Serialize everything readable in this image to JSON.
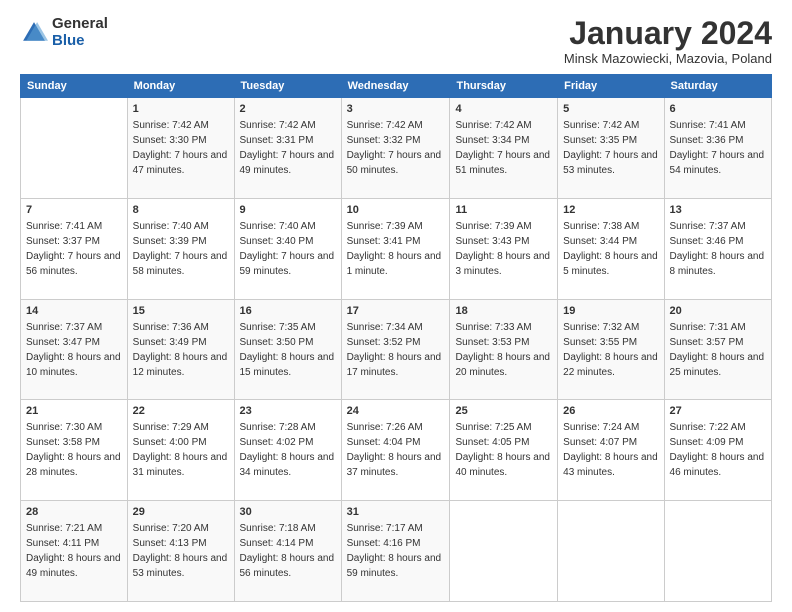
{
  "logo": {
    "general": "General",
    "blue": "Blue"
  },
  "header": {
    "month": "January 2024",
    "location": "Minsk Mazowiecki, Mazovia, Poland"
  },
  "days_of_week": [
    "Sunday",
    "Monday",
    "Tuesday",
    "Wednesday",
    "Thursday",
    "Friday",
    "Saturday"
  ],
  "weeks": [
    [
      {
        "day": "",
        "sunrise": "",
        "sunset": "",
        "daylight": ""
      },
      {
        "day": "1",
        "sunrise": "Sunrise: 7:42 AM",
        "sunset": "Sunset: 3:30 PM",
        "daylight": "Daylight: 7 hours and 47 minutes."
      },
      {
        "day": "2",
        "sunrise": "Sunrise: 7:42 AM",
        "sunset": "Sunset: 3:31 PM",
        "daylight": "Daylight: 7 hours and 49 minutes."
      },
      {
        "day": "3",
        "sunrise": "Sunrise: 7:42 AM",
        "sunset": "Sunset: 3:32 PM",
        "daylight": "Daylight: 7 hours and 50 minutes."
      },
      {
        "day": "4",
        "sunrise": "Sunrise: 7:42 AM",
        "sunset": "Sunset: 3:34 PM",
        "daylight": "Daylight: 7 hours and 51 minutes."
      },
      {
        "day": "5",
        "sunrise": "Sunrise: 7:42 AM",
        "sunset": "Sunset: 3:35 PM",
        "daylight": "Daylight: 7 hours and 53 minutes."
      },
      {
        "day": "6",
        "sunrise": "Sunrise: 7:41 AM",
        "sunset": "Sunset: 3:36 PM",
        "daylight": "Daylight: 7 hours and 54 minutes."
      }
    ],
    [
      {
        "day": "7",
        "sunrise": "Sunrise: 7:41 AM",
        "sunset": "Sunset: 3:37 PM",
        "daylight": "Daylight: 7 hours and 56 minutes."
      },
      {
        "day": "8",
        "sunrise": "Sunrise: 7:40 AM",
        "sunset": "Sunset: 3:39 PM",
        "daylight": "Daylight: 7 hours and 58 minutes."
      },
      {
        "day": "9",
        "sunrise": "Sunrise: 7:40 AM",
        "sunset": "Sunset: 3:40 PM",
        "daylight": "Daylight: 7 hours and 59 minutes."
      },
      {
        "day": "10",
        "sunrise": "Sunrise: 7:39 AM",
        "sunset": "Sunset: 3:41 PM",
        "daylight": "Daylight: 8 hours and 1 minute."
      },
      {
        "day": "11",
        "sunrise": "Sunrise: 7:39 AM",
        "sunset": "Sunset: 3:43 PM",
        "daylight": "Daylight: 8 hours and 3 minutes."
      },
      {
        "day": "12",
        "sunrise": "Sunrise: 7:38 AM",
        "sunset": "Sunset: 3:44 PM",
        "daylight": "Daylight: 8 hours and 5 minutes."
      },
      {
        "day": "13",
        "sunrise": "Sunrise: 7:37 AM",
        "sunset": "Sunset: 3:46 PM",
        "daylight": "Daylight: 8 hours and 8 minutes."
      }
    ],
    [
      {
        "day": "14",
        "sunrise": "Sunrise: 7:37 AM",
        "sunset": "Sunset: 3:47 PM",
        "daylight": "Daylight: 8 hours and 10 minutes."
      },
      {
        "day": "15",
        "sunrise": "Sunrise: 7:36 AM",
        "sunset": "Sunset: 3:49 PM",
        "daylight": "Daylight: 8 hours and 12 minutes."
      },
      {
        "day": "16",
        "sunrise": "Sunrise: 7:35 AM",
        "sunset": "Sunset: 3:50 PM",
        "daylight": "Daylight: 8 hours and 15 minutes."
      },
      {
        "day": "17",
        "sunrise": "Sunrise: 7:34 AM",
        "sunset": "Sunset: 3:52 PM",
        "daylight": "Daylight: 8 hours and 17 minutes."
      },
      {
        "day": "18",
        "sunrise": "Sunrise: 7:33 AM",
        "sunset": "Sunset: 3:53 PM",
        "daylight": "Daylight: 8 hours and 20 minutes."
      },
      {
        "day": "19",
        "sunrise": "Sunrise: 7:32 AM",
        "sunset": "Sunset: 3:55 PM",
        "daylight": "Daylight: 8 hours and 22 minutes."
      },
      {
        "day": "20",
        "sunrise": "Sunrise: 7:31 AM",
        "sunset": "Sunset: 3:57 PM",
        "daylight": "Daylight: 8 hours and 25 minutes."
      }
    ],
    [
      {
        "day": "21",
        "sunrise": "Sunrise: 7:30 AM",
        "sunset": "Sunset: 3:58 PM",
        "daylight": "Daylight: 8 hours and 28 minutes."
      },
      {
        "day": "22",
        "sunrise": "Sunrise: 7:29 AM",
        "sunset": "Sunset: 4:00 PM",
        "daylight": "Daylight: 8 hours and 31 minutes."
      },
      {
        "day": "23",
        "sunrise": "Sunrise: 7:28 AM",
        "sunset": "Sunset: 4:02 PM",
        "daylight": "Daylight: 8 hours and 34 minutes."
      },
      {
        "day": "24",
        "sunrise": "Sunrise: 7:26 AM",
        "sunset": "Sunset: 4:04 PM",
        "daylight": "Daylight: 8 hours and 37 minutes."
      },
      {
        "day": "25",
        "sunrise": "Sunrise: 7:25 AM",
        "sunset": "Sunset: 4:05 PM",
        "daylight": "Daylight: 8 hours and 40 minutes."
      },
      {
        "day": "26",
        "sunrise": "Sunrise: 7:24 AM",
        "sunset": "Sunset: 4:07 PM",
        "daylight": "Daylight: 8 hours and 43 minutes."
      },
      {
        "day": "27",
        "sunrise": "Sunrise: 7:22 AM",
        "sunset": "Sunset: 4:09 PM",
        "daylight": "Daylight: 8 hours and 46 minutes."
      }
    ],
    [
      {
        "day": "28",
        "sunrise": "Sunrise: 7:21 AM",
        "sunset": "Sunset: 4:11 PM",
        "daylight": "Daylight: 8 hours and 49 minutes."
      },
      {
        "day": "29",
        "sunrise": "Sunrise: 7:20 AM",
        "sunset": "Sunset: 4:13 PM",
        "daylight": "Daylight: 8 hours and 53 minutes."
      },
      {
        "day": "30",
        "sunrise": "Sunrise: 7:18 AM",
        "sunset": "Sunset: 4:14 PM",
        "daylight": "Daylight: 8 hours and 56 minutes."
      },
      {
        "day": "31",
        "sunrise": "Sunrise: 7:17 AM",
        "sunset": "Sunset: 4:16 PM",
        "daylight": "Daylight: 8 hours and 59 minutes."
      },
      {
        "day": "",
        "sunrise": "",
        "sunset": "",
        "daylight": ""
      },
      {
        "day": "",
        "sunrise": "",
        "sunset": "",
        "daylight": ""
      },
      {
        "day": "",
        "sunrise": "",
        "sunset": "",
        "daylight": ""
      }
    ]
  ]
}
